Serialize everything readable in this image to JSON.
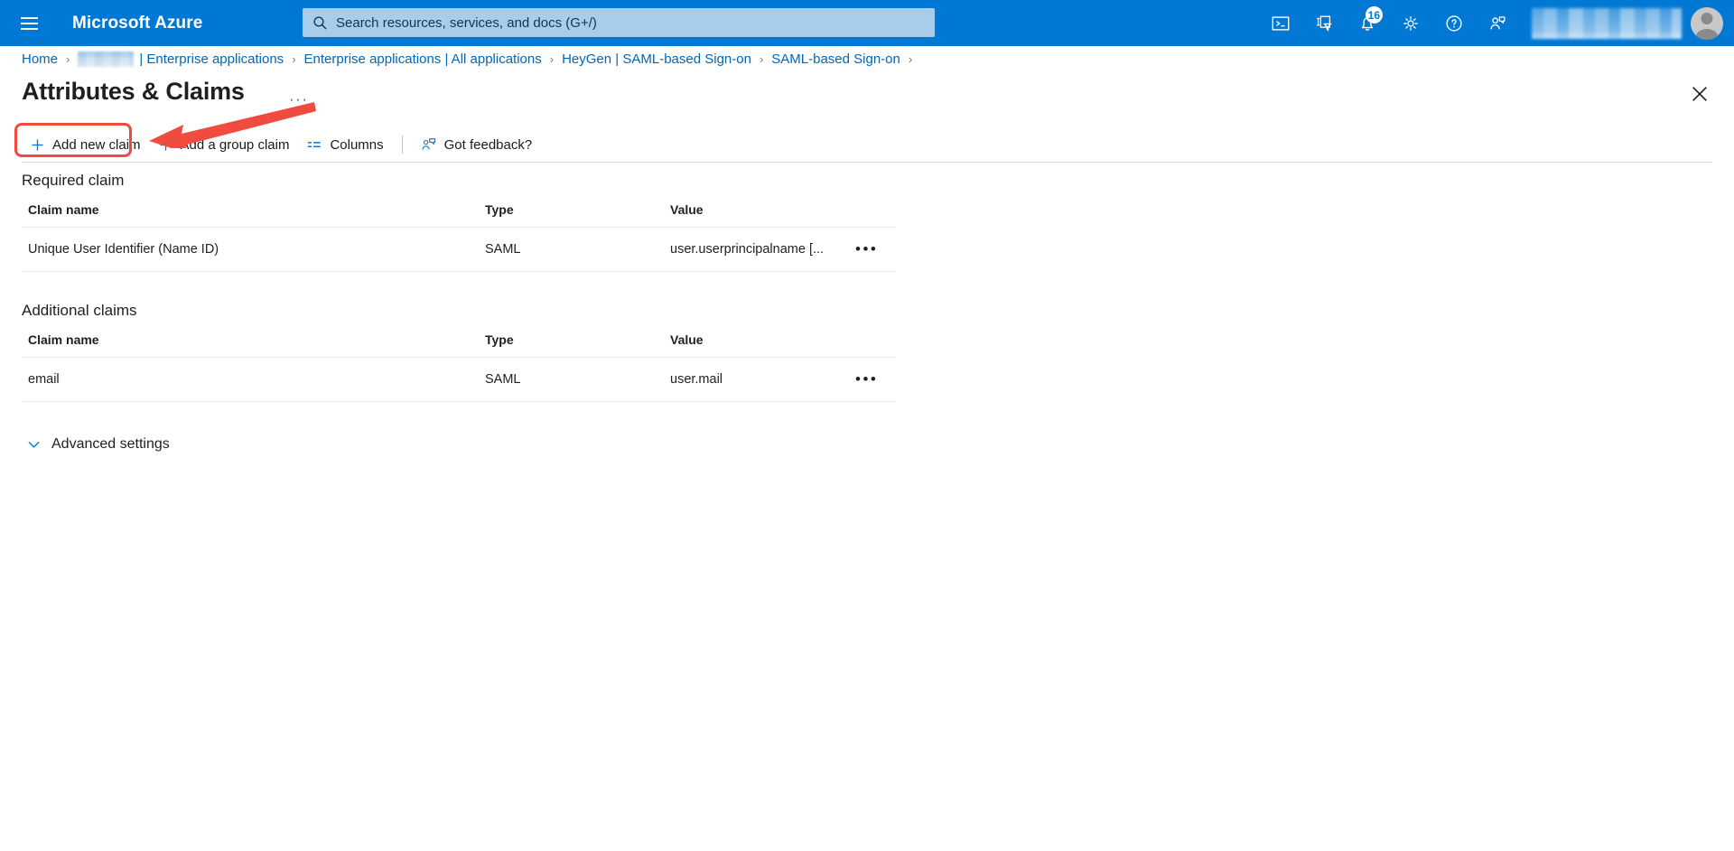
{
  "topbar": {
    "brand": "Microsoft Azure",
    "menu_icon": "hamburger-icon",
    "search": {
      "placeholder": "Search resources, services, and docs (G+/)",
      "icon": "search-icon"
    },
    "icons": [
      {
        "name": "cloud-shell-icon",
        "label": "Cloud Shell"
      },
      {
        "name": "directories-subscriptions-icon",
        "label": "Directories + subscriptions"
      },
      {
        "name": "notifications-bell-icon",
        "label": "Notifications",
        "badge": "16"
      },
      {
        "name": "settings-gear-icon",
        "label": "Settings"
      },
      {
        "name": "help-question-icon",
        "label": "Help"
      },
      {
        "name": "feedback-person-icon",
        "label": "Feedback"
      }
    ],
    "avatar": "user-avatar"
  },
  "breadcrumb": {
    "items": [
      {
        "label": "Home",
        "type": "link"
      },
      {
        "label": "",
        "type": "blurred"
      },
      {
        "label": "| Enterprise applications",
        "type": "link"
      },
      {
        "label": "Enterprise applications | All applications",
        "type": "link"
      },
      {
        "label": "HeyGen | SAML-based Sign-on",
        "type": "link"
      },
      {
        "label": "SAML-based Sign-on",
        "type": "link"
      }
    ],
    "separator": "›"
  },
  "page": {
    "title": "Attributes & Claims",
    "more_menu": "···",
    "close_label": "Close"
  },
  "commandbar": {
    "add_new_claim": "Add new claim",
    "add_group_claim": "Add a group claim",
    "columns": "Columns",
    "got_feedback": "Got feedback?"
  },
  "annotation": {
    "highlight_target": "Add new claim",
    "color": "#f04b3f",
    "arrow_direction": "points-left-to-add-new-claim"
  },
  "required_claim": {
    "heading": "Required claim",
    "columns": [
      "Claim name",
      "Type",
      "Value",
      ""
    ],
    "rows": [
      {
        "name": "Unique User Identifier (Name ID)",
        "type": "SAML",
        "value": "user.userprincipalname [...",
        "menu": "•••"
      }
    ]
  },
  "additional_claims": {
    "heading": "Additional claims",
    "columns": [
      "Claim name",
      "Type",
      "Value",
      ""
    ],
    "rows": [
      {
        "name": "email",
        "type": "SAML",
        "value": "user.mail",
        "menu": "•••"
      }
    ]
  },
  "advanced_settings": {
    "label": "Advanced settings",
    "expanded": false,
    "chevron": "chevron-down-icon"
  },
  "colors": {
    "azure_blue": "#0078d4",
    "link_blue": "#0067b8",
    "annotation_red": "#f04b3f",
    "text_primary": "#201f1e",
    "divider": "#edebe9"
  }
}
